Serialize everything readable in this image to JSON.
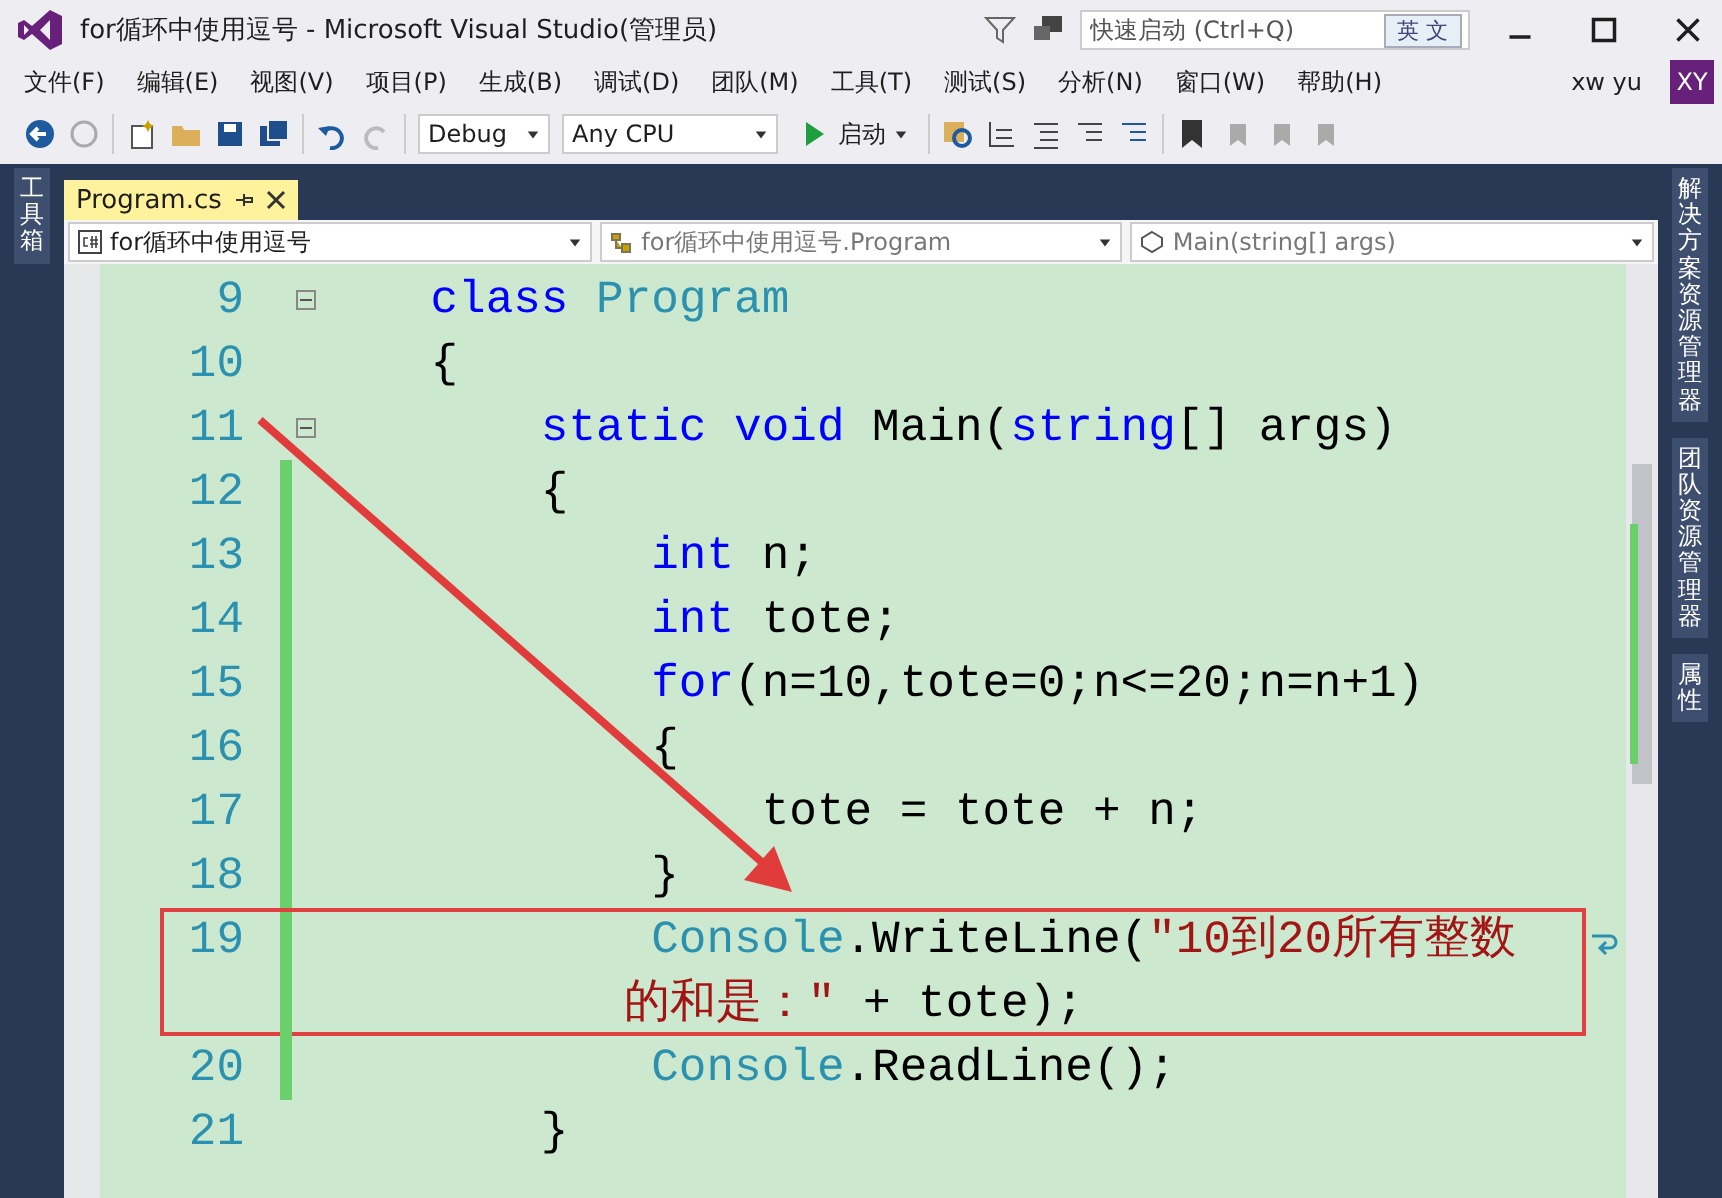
{
  "window": {
    "title": "for循环中使用逗号 - Microsoft Visual Studio(管理员)",
    "quick_launch": {
      "placeholder": "快速启动 (Ctrl+Q)"
    },
    "ime_badge": "英 文"
  },
  "menu": [
    "文件(F)",
    "编辑(E)",
    "视图(V)",
    "项目(P)",
    "生成(B)",
    "调试(D)",
    "团队(M)",
    "工具(T)",
    "测试(S)",
    "分析(N)",
    "窗口(W)",
    "帮助(H)"
  ],
  "account": {
    "name": "xw yu",
    "initials": "XY"
  },
  "toolbar": {
    "configuration": "Debug",
    "platform": "Any CPU",
    "start": "启动"
  },
  "left_panel": "工具箱",
  "right_panels": [
    "解决方案资源管理器",
    "团队资源管理器",
    "属性"
  ],
  "tabs": [
    {
      "label": "Program.cs",
      "selected": true
    }
  ],
  "nav_bar": [
    "for循环中使用逗号",
    "for循环中使用逗号.Program",
    "Main(string[] args)"
  ],
  "code_lines": [
    {
      "number": "9",
      "foldable": true,
      "changed": false,
      "highlighted": false,
      "tokens": [
        {
          "kind": "keyword",
          "text": "    class"
        },
        {
          "kind": "type",
          "text": " Program"
        }
      ]
    },
    {
      "number": "10",
      "foldable": false,
      "changed": false,
      "highlighted": false,
      "tokens": [
        {
          "kind": "plain",
          "text": "    {"
        }
      ]
    },
    {
      "number": "11",
      "foldable": true,
      "changed": false,
      "highlighted": false,
      "tokens": [
        {
          "kind": "keyword",
          "text": "        static"
        },
        {
          "kind": "keyword",
          "text": " void"
        },
        {
          "kind": "plain",
          "text": " Main("
        },
        {
          "kind": "keyword",
          "text": "string"
        },
        {
          "kind": "plain",
          "text": "[] args)"
        }
      ]
    },
    {
      "number": "12",
      "foldable": false,
      "changed": true,
      "highlighted": false,
      "tokens": [
        {
          "kind": "plain",
          "text": "        {"
        }
      ]
    },
    {
      "number": "13",
      "foldable": false,
      "changed": true,
      "highlighted": false,
      "tokens": [
        {
          "kind": "keyword",
          "text": "            int"
        },
        {
          "kind": "plain",
          "text": " n;"
        }
      ]
    },
    {
      "number": "14",
      "foldable": false,
      "changed": true,
      "highlighted": false,
      "tokens": [
        {
          "kind": "keyword",
          "text": "            int"
        },
        {
          "kind": "plain",
          "text": " tote;"
        }
      ]
    },
    {
      "number": "15",
      "foldable": false,
      "changed": true,
      "highlighted": false,
      "tokens": [
        {
          "kind": "keyword",
          "text": "            for"
        },
        {
          "kind": "plain",
          "text": "(n=10,tote=0;n<=20;n=n+1)"
        }
      ]
    },
    {
      "number": "16",
      "foldable": false,
      "changed": true,
      "highlighted": false,
      "tokens": [
        {
          "kind": "plain",
          "text": "            {"
        }
      ]
    },
    {
      "number": "17",
      "foldable": false,
      "changed": true,
      "highlighted": false,
      "tokens": [
        {
          "kind": "plain",
          "text": "                tote = tote + n;"
        }
      ]
    },
    {
      "number": "18",
      "foldable": false,
      "changed": true,
      "highlighted": false,
      "tokens": [
        {
          "kind": "plain",
          "text": "            }"
        }
      ]
    },
    {
      "number": "19",
      "foldable": false,
      "changed": true,
      "highlighted": true,
      "tokens": [
        {
          "kind": "type",
          "text": "            Console"
        },
        {
          "kind": "plain",
          "text": ".WriteLine("
        },
        {
          "kind": "string",
          "text": "\"10到20所有整数"
        }
      ],
      "continuation": [
        {
          "kind": "string",
          "text": "           的和是：\""
        },
        {
          "kind": "plain",
          "text": " + tote);"
        }
      ]
    },
    {
      "number": "20",
      "foldable": false,
      "changed": true,
      "highlighted": false,
      "tokens": [
        {
          "kind": "type",
          "text": "            Console"
        },
        {
          "kind": "plain",
          "text": ".ReadLine();"
        }
      ]
    },
    {
      "number": "21",
      "foldable": false,
      "changed": false,
      "highlighted": false,
      "tokens": [
        {
          "kind": "plain",
          "text": "        }"
        }
      ]
    }
  ]
}
